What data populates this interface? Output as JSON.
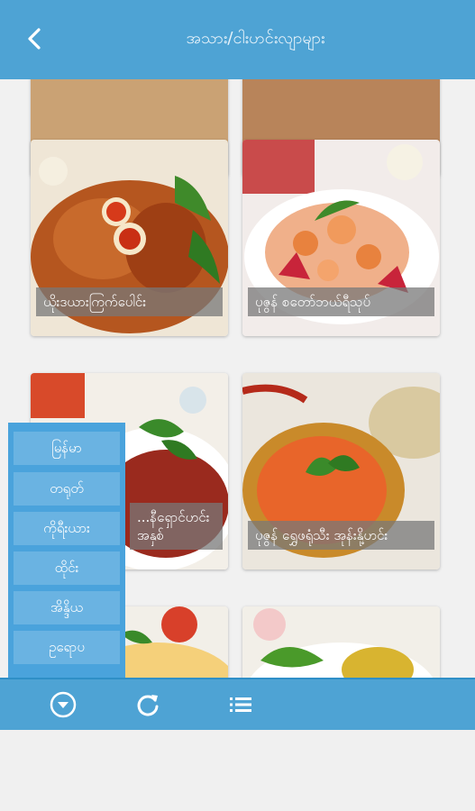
{
  "header": {
    "title": "အသား/ငါးဟင်းလျာများ"
  },
  "recipes": [
    {
      "caption": "ယိုးဒယားကြက်ပေါင်း"
    },
    {
      "caption": "ပုဇွန် စတော်ဘယ်ရီသုပ်"
    },
    {
      "caption": "...နီရှောင်ဟင်း အနှစ်"
    },
    {
      "caption": "ပုဇွန် ရွှေဖရုံသီး အုန်းနို့ဟင်း"
    }
  ],
  "language_menu": {
    "items": [
      "မြန်မာ",
      "တရုတ်",
      "ကိုရီးယား",
      "ထိုင်း",
      "အိန္ဒိယ",
      "ဥရောပ"
    ]
  },
  "footer": {
    "icons": [
      "chevron-down-circle-icon",
      "refresh-icon",
      "list-icon"
    ]
  },
  "colors": {
    "primary": "#4ea3d4",
    "menu": "#4aa3dc"
  }
}
